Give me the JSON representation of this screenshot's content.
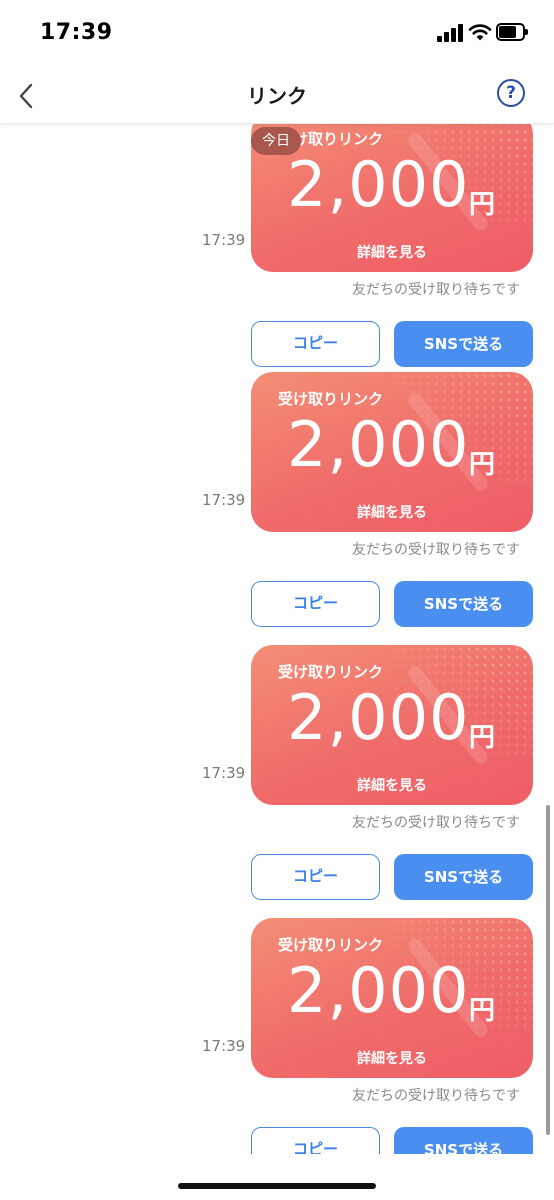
{
  "status_bar": {
    "time": "17:39"
  },
  "nav": {
    "title": "リンク",
    "help_label": "?"
  },
  "colors": {
    "accent_blue": "#4a8ff0",
    "card_coral": "#f06c6a"
  },
  "icons": {
    "back": "chevron-left-icon",
    "help": "question-circle-icon"
  },
  "items": [
    {
      "time": "17:39",
      "label": "受け取りリンク",
      "amount": "2,000",
      "unit": "円",
      "detail": "詳細を見る",
      "badge": "今日",
      "status": "友だちの受け取り待ちです",
      "copy": "コピー",
      "sns": "SNSで送る"
    },
    {
      "time": "17:39",
      "label": "受け取りリンク",
      "amount": "2,000",
      "unit": "円",
      "detail": "詳細を見る",
      "status": "友だちの受け取り待ちです",
      "copy": "コピー",
      "sns": "SNSで送る"
    },
    {
      "time": "17:39",
      "label": "受け取りリンク",
      "amount": "2,000",
      "unit": "円",
      "detail": "詳細を見る",
      "status": "友だちの受け取り待ちです",
      "copy": "コピー",
      "sns": "SNSで送る"
    },
    {
      "time": "17:39",
      "label": "受け取りリンク",
      "amount": "2,000",
      "unit": "円",
      "detail": "詳細を見る",
      "status": "友だちの受け取り待ちです",
      "copy": "コピー",
      "sns": "SNSで送る"
    },
    {
      "copy": "コピー",
      "sns": "SNSで送る"
    }
  ]
}
